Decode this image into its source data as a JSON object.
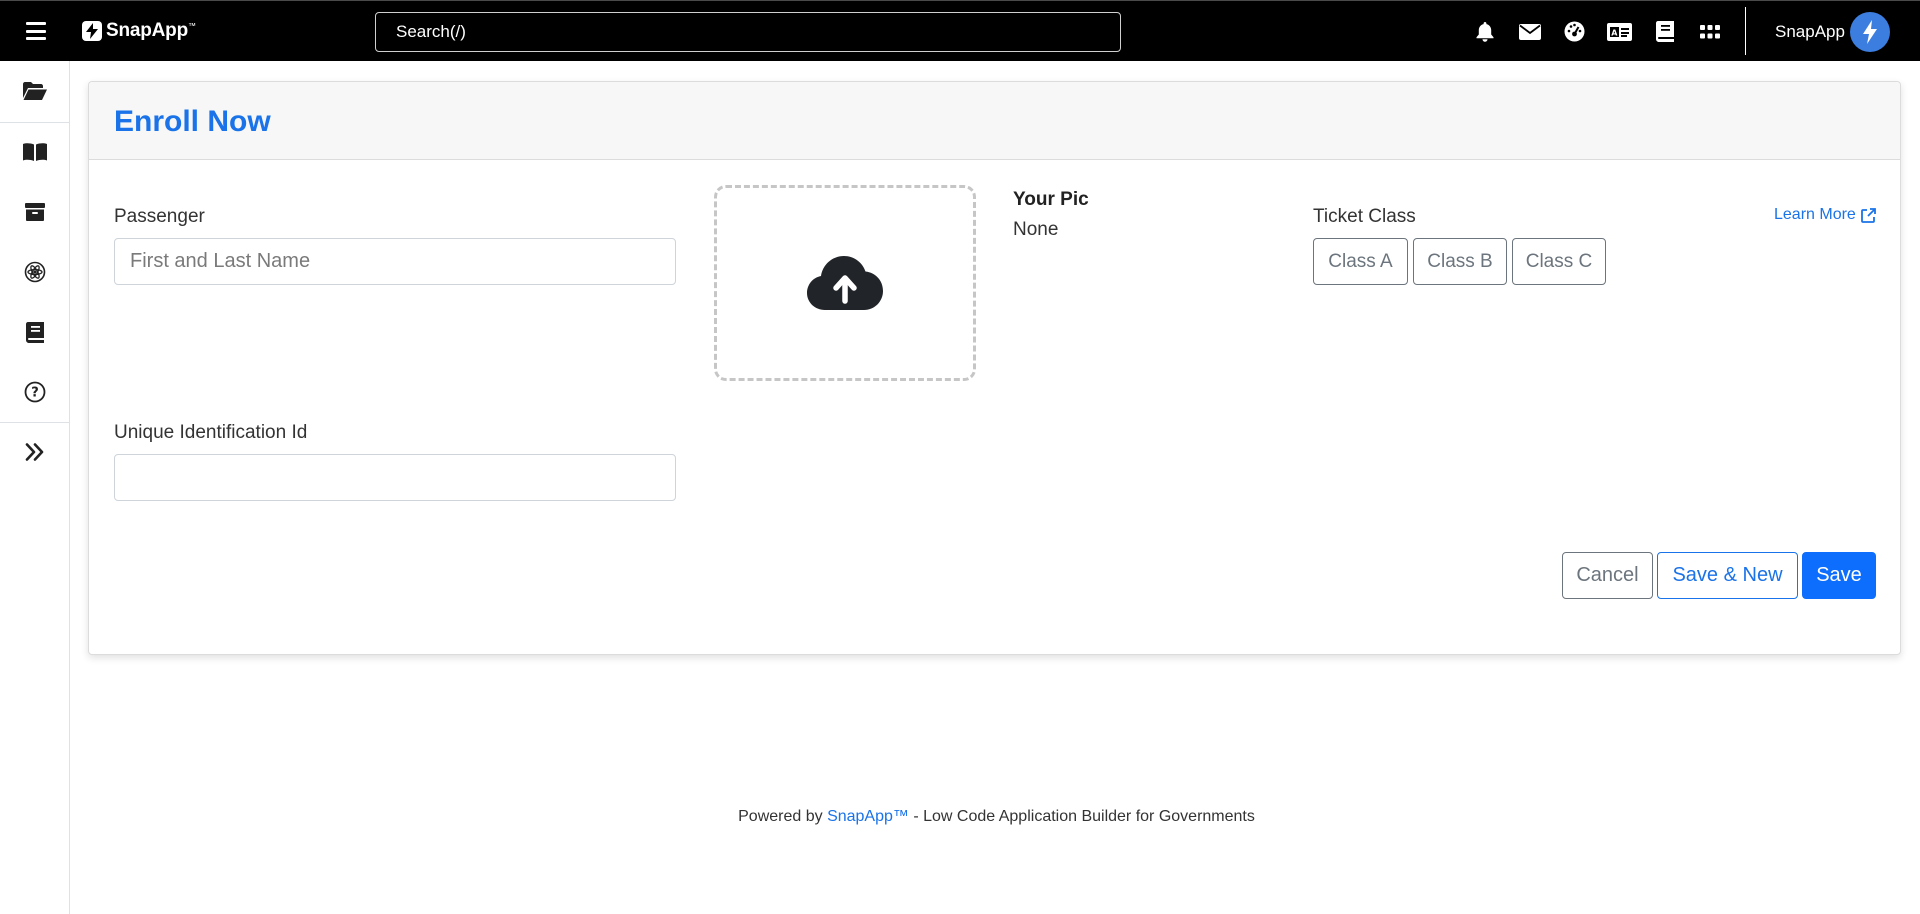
{
  "header": {
    "logo_text": "SnapApp",
    "logo_tm": "™",
    "search_placeholder": "Search(/)",
    "user_name": "SnapApp",
    "icons": [
      "bell-icon",
      "envelope-icon",
      "dashboard-icon",
      "id-card-icon",
      "book-icon",
      "apps-grid-icon"
    ]
  },
  "sidebar": {
    "items": [
      "folder-open-icon",
      "book-open-icon",
      "archive-icon",
      "atom-icon",
      "book-icon",
      "help-circle-icon"
    ],
    "expand_icon": "double-chevron-right-icon"
  },
  "form": {
    "title": "Enroll Now",
    "passenger_label": "Passenger",
    "passenger_placeholder": "First and Last Name",
    "passenger_value": "",
    "uid_label": "Unique Identification Id",
    "uid_value": "",
    "pic_label": "Your Pic",
    "pic_value": "None",
    "ticket_class_label": "Ticket Class",
    "ticket_classes": [
      "Class A",
      "Class B",
      "Class C"
    ],
    "learn_more": "Learn More",
    "cancel": "Cancel",
    "save_new": "Save & New",
    "save": "Save"
  },
  "footer": {
    "prefix": "Powered by ",
    "brand": "SnapApp™",
    "suffix": " - Low Code Application Builder for Governments"
  },
  "colors": {
    "primary": "#1a73e8",
    "button_primary": "#0d6efd",
    "topbar": "#000000",
    "avatar": "#3c7ee0"
  }
}
